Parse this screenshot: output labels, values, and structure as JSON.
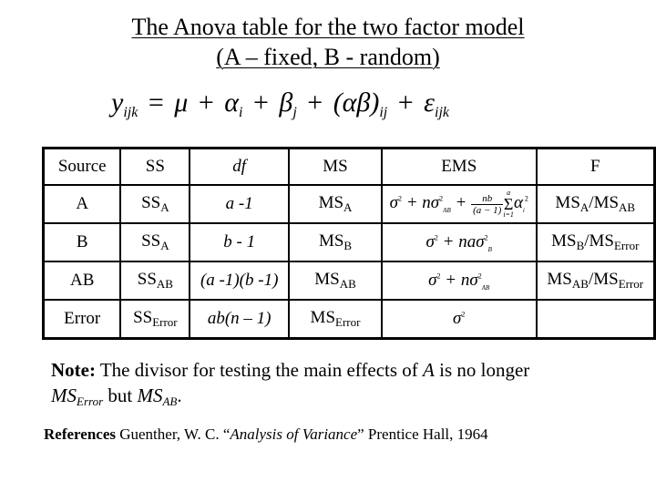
{
  "title": {
    "line1": "The Anova table for the two factor model",
    "line2": "(A – fixed, B - random)"
  },
  "model_formula": {
    "lhs": "y",
    "lhs_sub": "ijk",
    "terms": [
      "μ",
      "α",
      "β",
      "(αβ)",
      "ε"
    ],
    "term_subs": [
      "",
      "i",
      "j",
      "ij",
      "ijk"
    ],
    "equals": "=",
    "plus": "+"
  },
  "table": {
    "headers": [
      "Source",
      "SS",
      "df",
      "MS",
      "EMS",
      "F"
    ],
    "rows": [
      {
        "source": "A",
        "ss": "SS",
        "ss_sub": "A",
        "df": "a -1",
        "ms": "MS",
        "ms_sub": "A",
        "ems": "σ² + nσ²_AB + nb/(a−1) Σ_{i=1}^{a} α_i²",
        "f_num": "MS",
        "f_num_sub": "A",
        "f_den": "MS",
        "f_den_sub": "AB"
      },
      {
        "source": "B",
        "ss": "SS",
        "ss_sub": "A",
        "df": "b - 1",
        "ms": "MS",
        "ms_sub": "B",
        "ems": "σ² + naσ²_B",
        "f_num": "MS",
        "f_num_sub": "B",
        "f_den": "MS",
        "f_den_sub": "Error"
      },
      {
        "source": "AB",
        "ss": "SS",
        "ss_sub": "AB",
        "df": "(a -1)(b -1)",
        "ms": "MS",
        "ms_sub": "AB",
        "ems": "σ² + nσ²_AB",
        "f_num": "MS",
        "f_num_sub": "AB",
        "f_den": "MS",
        "f_den_sub": "Error"
      },
      {
        "source": "Error",
        "ss": "SS",
        "ss_sub": "Error",
        "df": "ab(n – 1)",
        "ms": "MS",
        "ms_sub": "Error",
        "ems": "σ²",
        "f_num": "",
        "f_num_sub": "",
        "f_den": "",
        "f_den_sub": ""
      }
    ]
  },
  "note": {
    "label": "Note:",
    "text1": " The divisor for testing the main effects of ",
    "var": "A",
    "text2": " is no longer",
    "ms1": "MS",
    "ms1_sub": "Error",
    "mid": " but ",
    "ms2": "MS",
    "ms2_sub": "AB",
    "end": "."
  },
  "references": {
    "label": "References",
    "author": " Guenther, W. C. “",
    "book": "Analysis of Variance",
    "rest": "” Prentice Hall, 1964"
  }
}
